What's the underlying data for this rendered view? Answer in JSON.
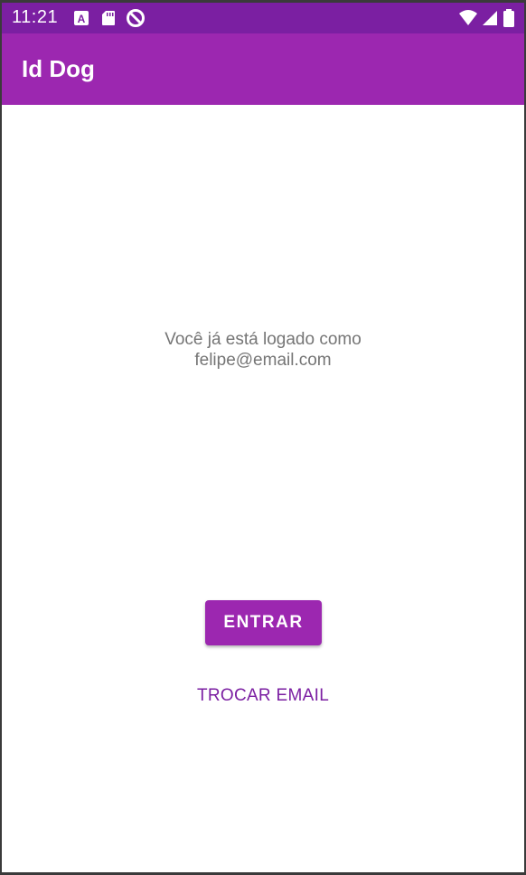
{
  "status_bar": {
    "time": "11:21",
    "left_icons": [
      "a-square-icon",
      "sd-card-icon",
      "no-sync-icon"
    ],
    "right_icons": [
      "wifi-icon",
      "signal-icon",
      "battery-icon"
    ],
    "background_color": "#7b1fa2"
  },
  "app_bar": {
    "title": "Id Dog",
    "background_color": "#9c27b0"
  },
  "main": {
    "message_line1": "Você já está logado como",
    "message_line2": "felipe@email.com",
    "enter_button_label": "ENTRAR",
    "change_email_button_label": "TROCAR EMAIL"
  },
  "colors": {
    "accent": "#9c27b0",
    "accent_dark": "#7b1fa2",
    "text_secondary": "#757575"
  }
}
